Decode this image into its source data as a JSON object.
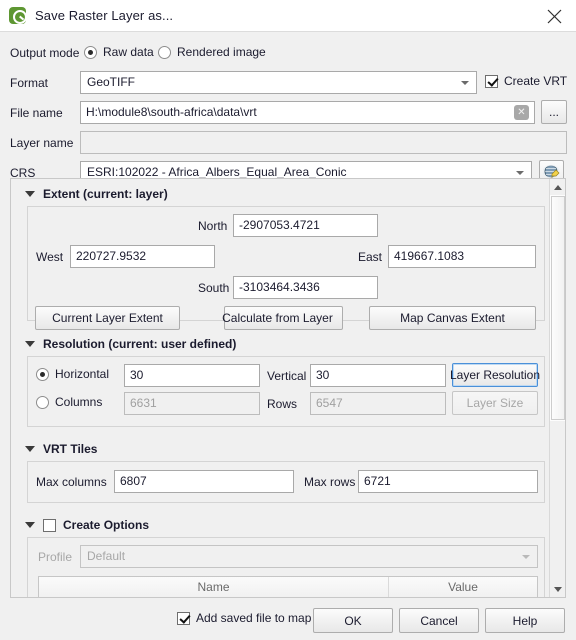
{
  "window": {
    "title": "Save Raster Layer as...",
    "logo_icon": "qgis-logo-icon",
    "close_icon": "close-icon"
  },
  "form": {
    "output_mode_label": "Output mode",
    "output_mode_options": [
      {
        "label": "Raw data",
        "selected": true
      },
      {
        "label": "Rendered image",
        "selected": false
      }
    ],
    "format_label": "Format",
    "format_value": "GeoTIFF",
    "create_vrt_label": "Create VRT",
    "create_vrt_checked": true,
    "file_name_label": "File name",
    "file_name_value": "H:\\module8\\south-africa\\data\\vrt",
    "file_name_clear_icon": "clear-icon",
    "browse_label": "...",
    "layer_name_label": "Layer name",
    "layer_name_value": "",
    "crs_label": "CRS",
    "crs_value": "ESRI:102022 - Africa_Albers_Equal_Area_Conic",
    "crs_select_icon": "globe-pencil-icon"
  },
  "extent": {
    "header": "Extent (current: layer)",
    "north_label": "North",
    "north_value": "-2907053.4721",
    "west_label": "West",
    "west_value": "220727.9532",
    "east_label": "East",
    "east_value": "419667.1083",
    "south_label": "South",
    "south_value": "-3103464.3436",
    "current_layer_extent_label": "Current Layer Extent",
    "calculate_from_layer_label": "Calculate from Layer",
    "map_canvas_extent_label": "Map Canvas Extent"
  },
  "resolution": {
    "header": "Resolution (current: user defined)",
    "horizontal_label": "Horizontal",
    "horizontal_value": "30",
    "horizontal_selected": true,
    "vertical_label": "Vertical",
    "vertical_value": "30",
    "columns_label": "Columns",
    "columns_value": "6631",
    "columns_selected": false,
    "rows_label": "Rows",
    "rows_value": "6547",
    "layer_resolution_label": "Layer Resolution",
    "layer_size_label": "Layer Size"
  },
  "vrt_tiles": {
    "header": "VRT Tiles",
    "max_columns_label": "Max columns",
    "max_columns_value": "6807",
    "max_rows_label": "Max rows",
    "max_rows_value": "6721"
  },
  "create_options": {
    "header": "Create Options",
    "checked": false,
    "profile_label": "Profile",
    "profile_value": "Default",
    "table_headers": [
      "Name",
      "Value"
    ]
  },
  "footer": {
    "add_saved_file_label": "Add saved file to map",
    "add_saved_file_checked": true,
    "ok_label": "OK",
    "cancel_label": "Cancel",
    "help_label": "Help"
  },
  "colors": {
    "accent": "#5e9732",
    "focus": "#4a90d9",
    "window_bg": "#f0f0f0"
  }
}
